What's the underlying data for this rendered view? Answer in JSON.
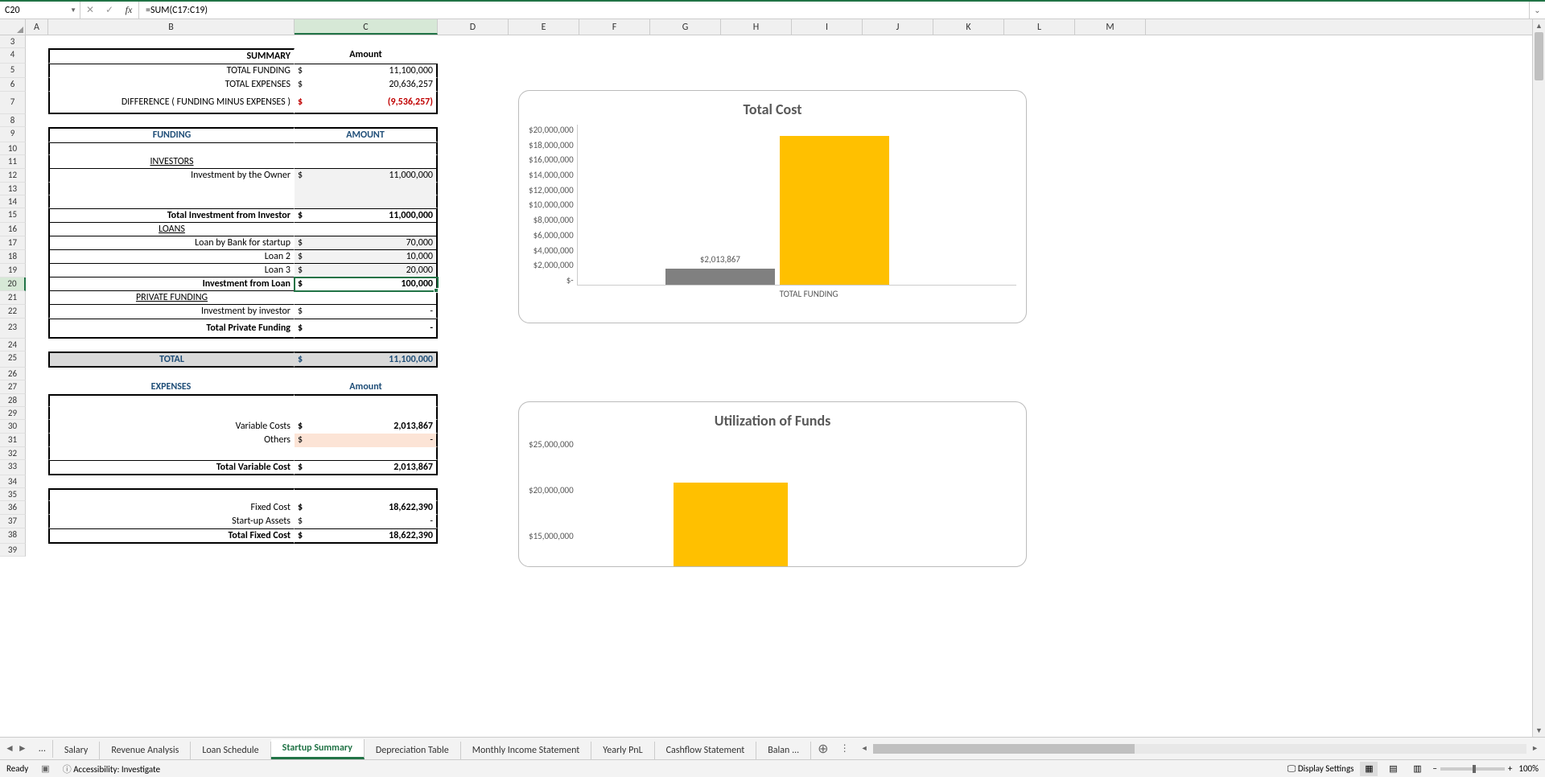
{
  "formula_bar": {
    "name_box": "C20",
    "formula": "=SUM(C17:C19)"
  },
  "columns": [
    "A",
    "B",
    "C",
    "D",
    "E",
    "F",
    "G",
    "H",
    "I",
    "J",
    "K",
    "L",
    "M"
  ],
  "summary": {
    "header": "SUMMARY",
    "amount_label": "Amount",
    "rows": [
      {
        "label": "TOTAL FUNDING",
        "cur": "$",
        "val": "11,100,000"
      },
      {
        "label": "TOTAL EXPENSES",
        "cur": "$",
        "val": "20,636,257"
      },
      {
        "label": "DIFFERENCE  ( FUNDING MINUS EXPENSES )",
        "cur": "$",
        "val": "(9,536,257)"
      }
    ]
  },
  "funding": {
    "title": "FUNDING",
    "amount_label": "AMOUNT",
    "investors_label": "INVESTORS",
    "investor_row": {
      "label": "Investment by the Owner",
      "cur": "$",
      "val": "11,000,000"
    },
    "total_investor": {
      "label": "Total Investment from Investor",
      "cur": "$",
      "val": "11,000,000"
    },
    "loans_label": "LOANS",
    "loans": [
      {
        "label": "Loan by Bank for startup",
        "cur": "$",
        "val": "70,000"
      },
      {
        "label": "Loan 2",
        "cur": "$",
        "val": "10,000"
      },
      {
        "label": "Loan 3",
        "cur": "$",
        "val": "20,000"
      }
    ],
    "investment_loan": {
      "label": "Investment from Loan",
      "cur": "$",
      "val": "100,000"
    },
    "private_label": "PRIVATE FUNDING",
    "private_row": {
      "label": "Investment by investor",
      "cur": "$",
      "val": "-"
    },
    "total_private": {
      "label": "Total Private Funding",
      "cur": "$",
      "val": "-"
    },
    "total": {
      "label": "TOTAL",
      "cur": "$",
      "val": "11,100,000"
    }
  },
  "expenses": {
    "title": "EXPENSES",
    "amount_label": "Amount",
    "variable": [
      {
        "label": "Variable Costs",
        "cur": "$",
        "val": "2,013,867"
      },
      {
        "label": "Others",
        "cur": "$",
        "val": "-"
      }
    ],
    "total_variable": {
      "label": "Total Variable Cost",
      "cur": "$",
      "val": "2,013,867"
    },
    "fixed": [
      {
        "label": "Fixed Cost",
        "cur": "$",
        "val": "18,622,390"
      },
      {
        "label": "Start-up Assets",
        "cur": "$",
        "val": "-"
      }
    ],
    "total_fixed": {
      "label": "Total Fixed Cost",
      "cur": "$",
      "val": "18,622,390"
    }
  },
  "chart_data": [
    {
      "type": "bar",
      "title": "Total Cost",
      "series": [
        {
          "name": "grey",
          "values": [
            2013867
          ],
          "color": "#808080",
          "label": "$2,013,867"
        },
        {
          "name": "yellow",
          "values": [
            18622390
          ],
          "color": "#FFC000"
        }
      ],
      "categories": [
        "TOTAL FUNDING"
      ],
      "ylim": [
        0,
        20000000
      ],
      "yticks": [
        "$20,000,000",
        "$18,000,000",
        "$16,000,000",
        "$14,000,000",
        "$12,000,000",
        "$10,000,000",
        "$8,000,000",
        "$6,000,000",
        "$4,000,000",
        "$2,000,000",
        "$-"
      ],
      "xlabel": "TOTAL FUNDING"
    },
    {
      "type": "bar",
      "title": "Utilization of Funds",
      "series": [
        {
          "name": "yellow",
          "values": [
            20636257
          ],
          "color": "#FFC000"
        }
      ],
      "categories": [
        ""
      ],
      "ylim": [
        0,
        25000000
      ],
      "yticks": [
        "$25,000,000",
        "$20,000,000",
        "$15,000,000"
      ],
      "xlabel": ""
    }
  ],
  "tabs": {
    "overflow": "...",
    "list": [
      "Salary",
      "Revenue Analysis",
      "Loan Schedule",
      "Startup Summary",
      "Depreciation Table",
      "Monthly Income Statement",
      "Yearly PnL",
      "Cashflow Statement",
      "Balan ..."
    ],
    "active": "Startup Summary"
  },
  "status": {
    "ready": "Ready",
    "accessibility": "Accessibility: Investigate",
    "display_settings": "Display Settings",
    "zoom": "100%"
  }
}
